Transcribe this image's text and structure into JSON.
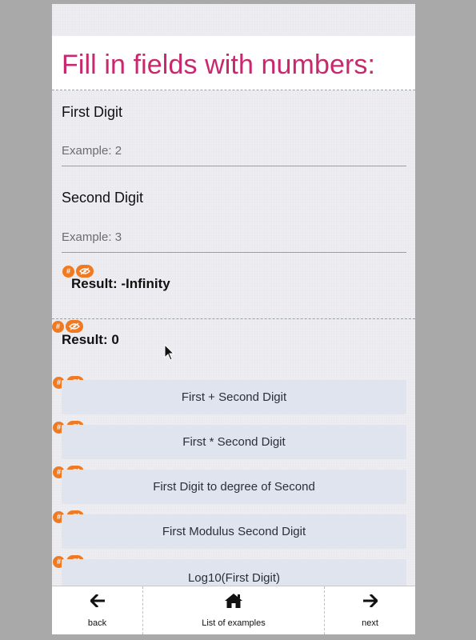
{
  "title": "Fill in fields with numbers:",
  "fields": [
    {
      "label": "First Digit",
      "value": "",
      "placeholder": "Example: 2"
    },
    {
      "label": "Second Digit",
      "value": "",
      "placeholder": "Example: 3"
    }
  ],
  "badges": {
    "hash": "#"
  },
  "results": [
    {
      "text": "Result: -Infinity"
    },
    {
      "text": "Result: 0"
    }
  ],
  "buttons": [
    {
      "label": "First + Second Digit"
    },
    {
      "label": "First * Second Digit"
    },
    {
      "label": "First Digit to degree of Second"
    },
    {
      "label": "First Modulus Second Digit"
    },
    {
      "label": "Log10(First Digit)"
    }
  ],
  "tabbar": {
    "back": {
      "label": "back",
      "icon": "arrow-left-icon"
    },
    "list": {
      "label": "List of examples",
      "icon": "home-icon"
    },
    "next": {
      "label": "next",
      "icon": "arrow-right-icon"
    }
  },
  "colors": {
    "title": "#c8286e",
    "badge": "#f07a22",
    "button_bg": "#dfe4ee",
    "page_bg": "#ececf1",
    "backdrop": "#a9a9a9"
  }
}
